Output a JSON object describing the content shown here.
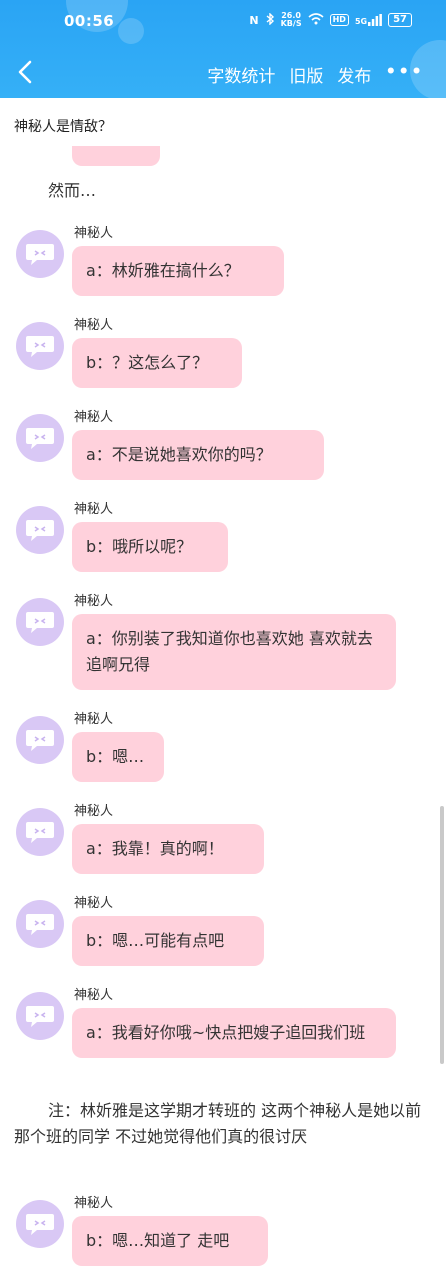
{
  "status_bar": {
    "time": "00:56",
    "nfc": "N",
    "net_speed_value": "26.0",
    "net_speed_unit": "KB/S",
    "hd": "HD",
    "signal": "5G",
    "battery": "57"
  },
  "nav": {
    "actions": [
      "字数统计",
      "旧版",
      "发布"
    ],
    "more": "•••"
  },
  "colors": {
    "header": "#2aa4f4",
    "bubble": "#ffd1dc",
    "avatar": "#d9c8f5"
  },
  "story": {
    "prev_line": "神秘人是情敌？",
    "narration1": "然而…",
    "messages": [
      {
        "sender": "神秘人",
        "text": "a：林妡雅在搞什么？"
      },
      {
        "sender": "神秘人",
        "text": "b：？这怎么了？"
      },
      {
        "sender": "神秘人",
        "text": "a：不是说她喜欢你的吗？"
      },
      {
        "sender": "神秘人",
        "text": "b：哦所以呢？"
      },
      {
        "sender": "神秘人",
        "text": "a：你别装了我知道你也喜欢她 喜欢就去追啊兄得"
      },
      {
        "sender": "神秘人",
        "text": "b：嗯…"
      },
      {
        "sender": "神秘人",
        "text": "a：我靠！真的啊！"
      },
      {
        "sender": "神秘人",
        "text": "b：嗯…可能有点吧"
      },
      {
        "sender": "神秘人",
        "text": "a：我看好你哦~快点把嫂子追回我们班"
      }
    ],
    "note": "注：林妡雅是这学期才转班的 这两个神秘人是她以前那个班的同学 不过她觉得他们真的很讨厌",
    "last_message": {
      "sender": "神秘人",
      "text": "b：嗯…知道了 走吧"
    }
  }
}
